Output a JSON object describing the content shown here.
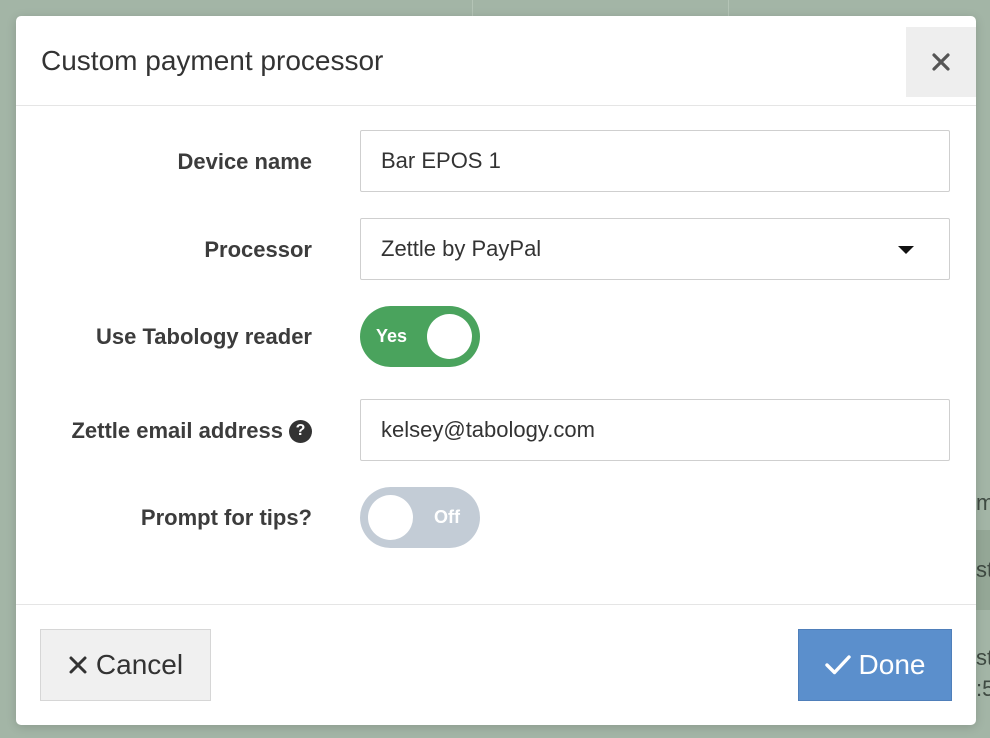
{
  "modal": {
    "title": "Custom payment processor",
    "close_icon": "close-icon"
  },
  "form": {
    "device_name": {
      "label": "Device name",
      "value": "Bar EPOS 1"
    },
    "processor": {
      "label": "Processor",
      "selected": "Zettle by PayPal"
    },
    "use_reader": {
      "label": "Use Tabology reader",
      "state": "Yes",
      "on": true
    },
    "zettle_email": {
      "label": "Zettle email address",
      "value": "kelsey@tabology.com",
      "help_icon": "?"
    },
    "prompt_tips": {
      "label": "Prompt for tips?",
      "state": "Off",
      "on": false
    }
  },
  "footer": {
    "cancel_label": "Cancel",
    "done_label": "Done"
  },
  "colors": {
    "toggle_on": "#4aa35d",
    "toggle_off": "#c3ccd6",
    "done_button": "#5b8fcc",
    "backdrop": "#a3b5a6"
  },
  "background": {
    "fragments": [
      "m",
      "st",
      "st",
      ":5"
    ]
  }
}
